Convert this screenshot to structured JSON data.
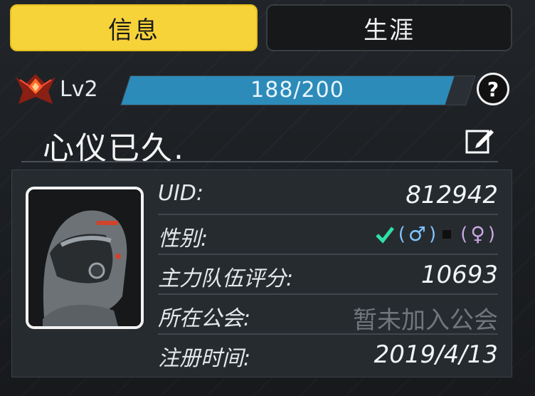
{
  "tabs": [
    {
      "label": "信息",
      "active": true
    },
    {
      "label": "生涯",
      "active": false
    }
  ],
  "level": {
    "label": "Lv2"
  },
  "xp": {
    "current": 188,
    "max": 200,
    "text": "188/200",
    "fill_color": "#2d8bb9"
  },
  "signature": "心仪已久.",
  "profile": {
    "uid_label": "UID:",
    "uid_value": "812942",
    "gender_label": "性别:",
    "gender_male_symbol": "♂",
    "gender_female_symbol": "♀",
    "gender_selected": "male",
    "power_label": "主力队伍评分:",
    "power_value": "10693",
    "guild_label": "所在公会:",
    "guild_value": "暂未加入公会",
    "reg_label": "注册时间:",
    "reg_value": "2019/4/13"
  },
  "icons": {
    "rank": "rank-emblem-icon",
    "help": "question-mark-icon",
    "edit": "edit-icon",
    "check": "check-icon",
    "male": "male-symbol-icon",
    "female": "female-symbol-icon"
  },
  "colors": {
    "accent_yellow": "#f7d33a",
    "xp_blue": "#2d8bb9"
  }
}
